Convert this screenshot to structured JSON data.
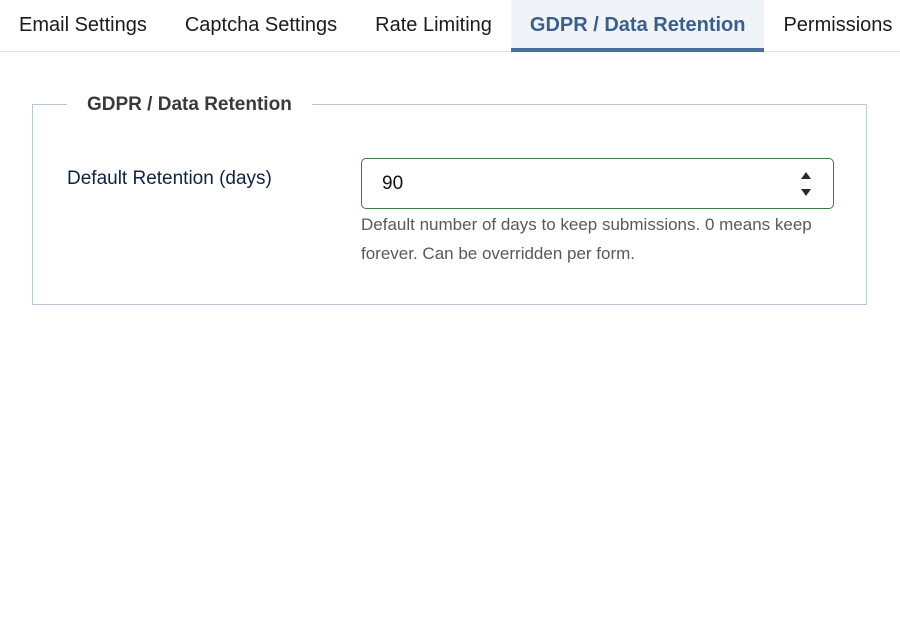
{
  "tabs": [
    {
      "label": "Email Settings",
      "active": false
    },
    {
      "label": "Captcha Settings",
      "active": false
    },
    {
      "label": "Rate Limiting",
      "active": false
    },
    {
      "label": "GDPR / Data Retention",
      "active": true
    },
    {
      "label": "Permissions",
      "active": false
    }
  ],
  "section": {
    "legend": "GDPR / Data Retention",
    "retention": {
      "label": "Default Retention (days)",
      "value": "90",
      "help": "Default number of days to keep submissions. 0 means keep forever. Can be overridden per form."
    }
  },
  "icons": {
    "spinner_up": "caret-up-icon",
    "spinner_down": "caret-down-icon"
  },
  "colors": {
    "active_tab_text": "#3b5f8c",
    "active_tab_underline": "#4a6f9e",
    "input_border": "#3f7a46",
    "label_text": "#0d2346"
  }
}
